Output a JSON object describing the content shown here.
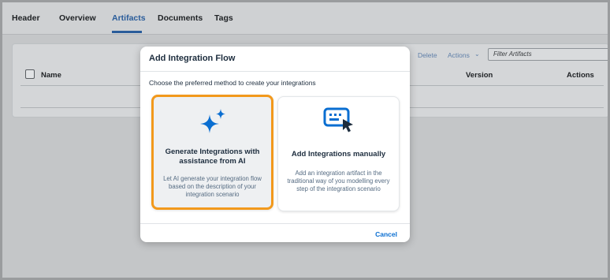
{
  "tabs": [
    {
      "label": "Header",
      "active": false
    },
    {
      "label": "Overview",
      "active": false
    },
    {
      "label": "Artifacts",
      "active": true
    },
    {
      "label": "Documents",
      "active": false
    },
    {
      "label": "Tags",
      "active": false
    }
  ],
  "toolbar": {
    "delete_label": "Delete",
    "actions_label": "Actions",
    "filter_placeholder": "Filter Artifacts"
  },
  "table": {
    "columns": [
      "Name",
      "Version",
      "Actions"
    ]
  },
  "dialog": {
    "title": "Add Integration Flow",
    "subtitle": "Choose the preferred method to create your integrations",
    "options": [
      {
        "icon": "ai-sparkle-icon",
        "title": "Generate Integrations with assistance from AI",
        "description": "Let AI generate your integration flow based on the description of your integration scenario",
        "selected": true
      },
      {
        "icon": "keyboard-cursor-icon",
        "title": "Add Integrations manually",
        "description": "Add an integration artifact in the traditional way of you modelling every step of the integration scenario",
        "selected": false
      }
    ],
    "cancel_label": "Cancel"
  },
  "colors": {
    "accent": "#0a6ed1",
    "selection_border": "#f2991c",
    "active_tab": "#2a5c9a"
  }
}
